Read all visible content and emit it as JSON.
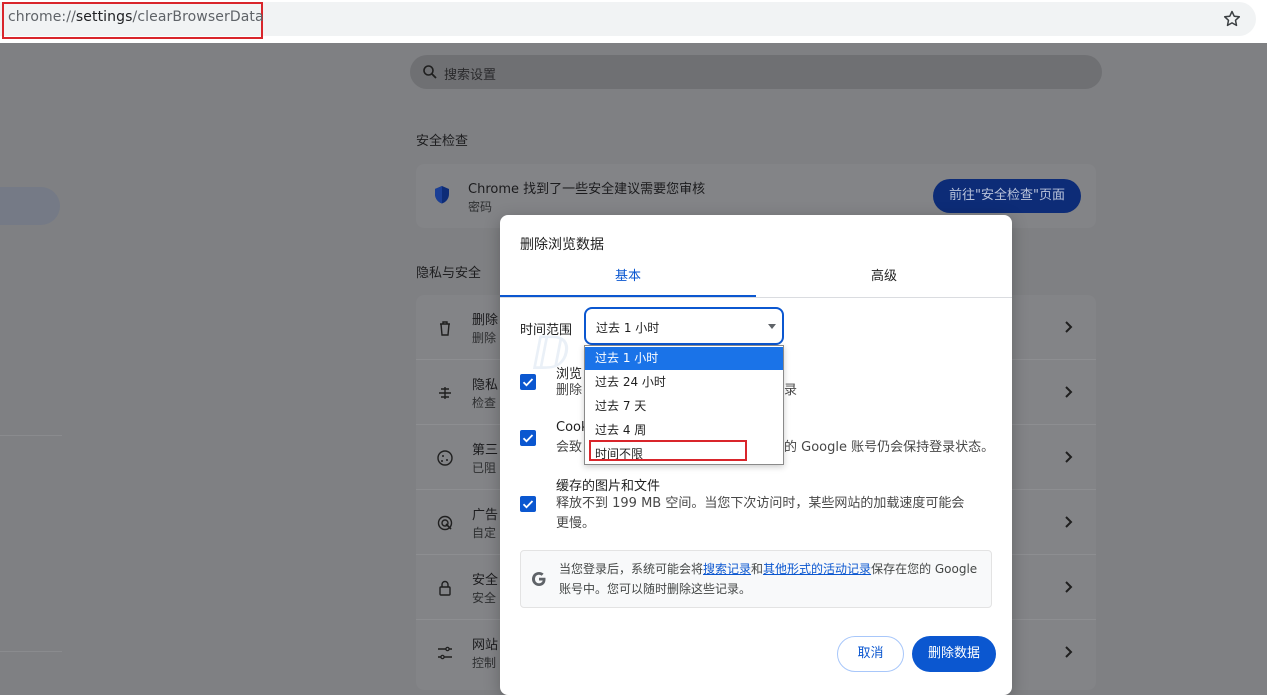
{
  "address_bar": {
    "url_scheme": "chrome://",
    "url_host": "settings",
    "url_path": "/clearBrowserData"
  },
  "search": {
    "placeholder": "搜索设置"
  },
  "safety_check": {
    "section_title": "安全检查",
    "title": "Chrome 找到了一些安全建议需要您审核",
    "subtitle": "密码",
    "button": "前往\"安全检查\"页面"
  },
  "privacy": {
    "section_title": "隐私与安全",
    "rows": [
      {
        "l1": "删除",
        "l2": "删除"
      },
      {
        "l1": "隐私",
        "l2": "检查"
      },
      {
        "l1": "第三",
        "l2": "已阻"
      },
      {
        "l1": "广告",
        "l2": "自定"
      },
      {
        "l1": "安全",
        "l2": "安全"
      },
      {
        "l1": "网站",
        "l2": "控制"
      }
    ]
  },
  "dialog": {
    "title": "删除浏览数据",
    "tabs": {
      "basic": "基本",
      "advanced": "高级"
    },
    "time_range_label": "时间范围",
    "time_range_value": "过去 1 小时",
    "items": [
      {
        "title": "浏览",
        "desc": "删除",
        "desc_tail": "录"
      },
      {
        "title": "Cook",
        "desc": "会致",
        "desc_tail": "的 Google 账号仍会保持登录状态。"
      },
      {
        "title": "缓存的图片和文件",
        "desc": "释放不到 199 MB 空间。当您下次访问时，某些网站的加载速度可能会更慢。"
      }
    ],
    "info": {
      "prefix": "当您登录后，系统可能会将",
      "link1": "搜索记录",
      "mid": "和",
      "link2": "其他形式的活动记录",
      "suffix": "保存在您的 Google 账号中。您可以随时删除这些记录。"
    },
    "cancel": "取消",
    "delete": "删除数据"
  },
  "dropdown": {
    "options": [
      "过去 1 小时",
      "过去 24 小时",
      "过去 7 天",
      "过去 4 周",
      "时间不限"
    ],
    "selected_index": 0
  },
  "colors": {
    "accent": "#0b57d0",
    "highlight": "#d9252b"
  }
}
